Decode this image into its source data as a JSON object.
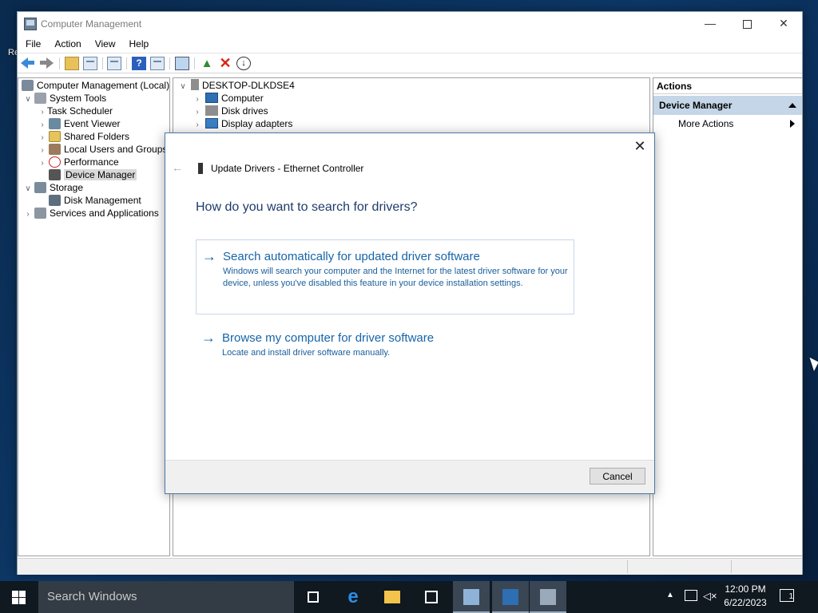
{
  "window": {
    "title": "Computer Management",
    "menu": [
      "File",
      "Action",
      "View",
      "Help"
    ]
  },
  "tree": {
    "root": "Computer Management (Local)",
    "system_tools": "System Tools",
    "task_scheduler": "Task Scheduler",
    "event_viewer": "Event Viewer",
    "shared_folders": "Shared Folders",
    "local_users": "Local Users and Groups",
    "performance": "Performance",
    "device_manager": "Device Manager",
    "storage": "Storage",
    "disk_management": "Disk Management",
    "services": "Services and Applications"
  },
  "devices": {
    "host": "DESKTOP-DLKDSE4",
    "items": [
      "Computer",
      "Disk drives",
      "Display adapters"
    ]
  },
  "actions": {
    "header": "Actions",
    "section": "Device Manager",
    "more": "More Actions"
  },
  "dialog": {
    "title": "Update Drivers - Ethernet Controller",
    "question": "How do you want to search for drivers?",
    "option1_title": "Search automatically for updated driver software",
    "option1_desc": "Windows will search your computer and the Internet for the latest driver software for your device, unless you've disabled this feature in your device installation settings.",
    "option2_title": "Browse my computer for driver software",
    "option2_desc": "Locate and install driver software manually.",
    "cancel": "Cancel"
  },
  "taskbar": {
    "search_placeholder": "Search Windows",
    "time": "12:00 PM",
    "date": "6/22/2023",
    "notifications": "1"
  },
  "icons": {
    "back": "back-arrow-icon",
    "forward": "forward-arrow-icon",
    "close": "close-icon"
  },
  "colors": {
    "accent_link": "#1665a8",
    "actions_section_bg": "#c4d6e8",
    "taskbar_bg": "#101820"
  }
}
